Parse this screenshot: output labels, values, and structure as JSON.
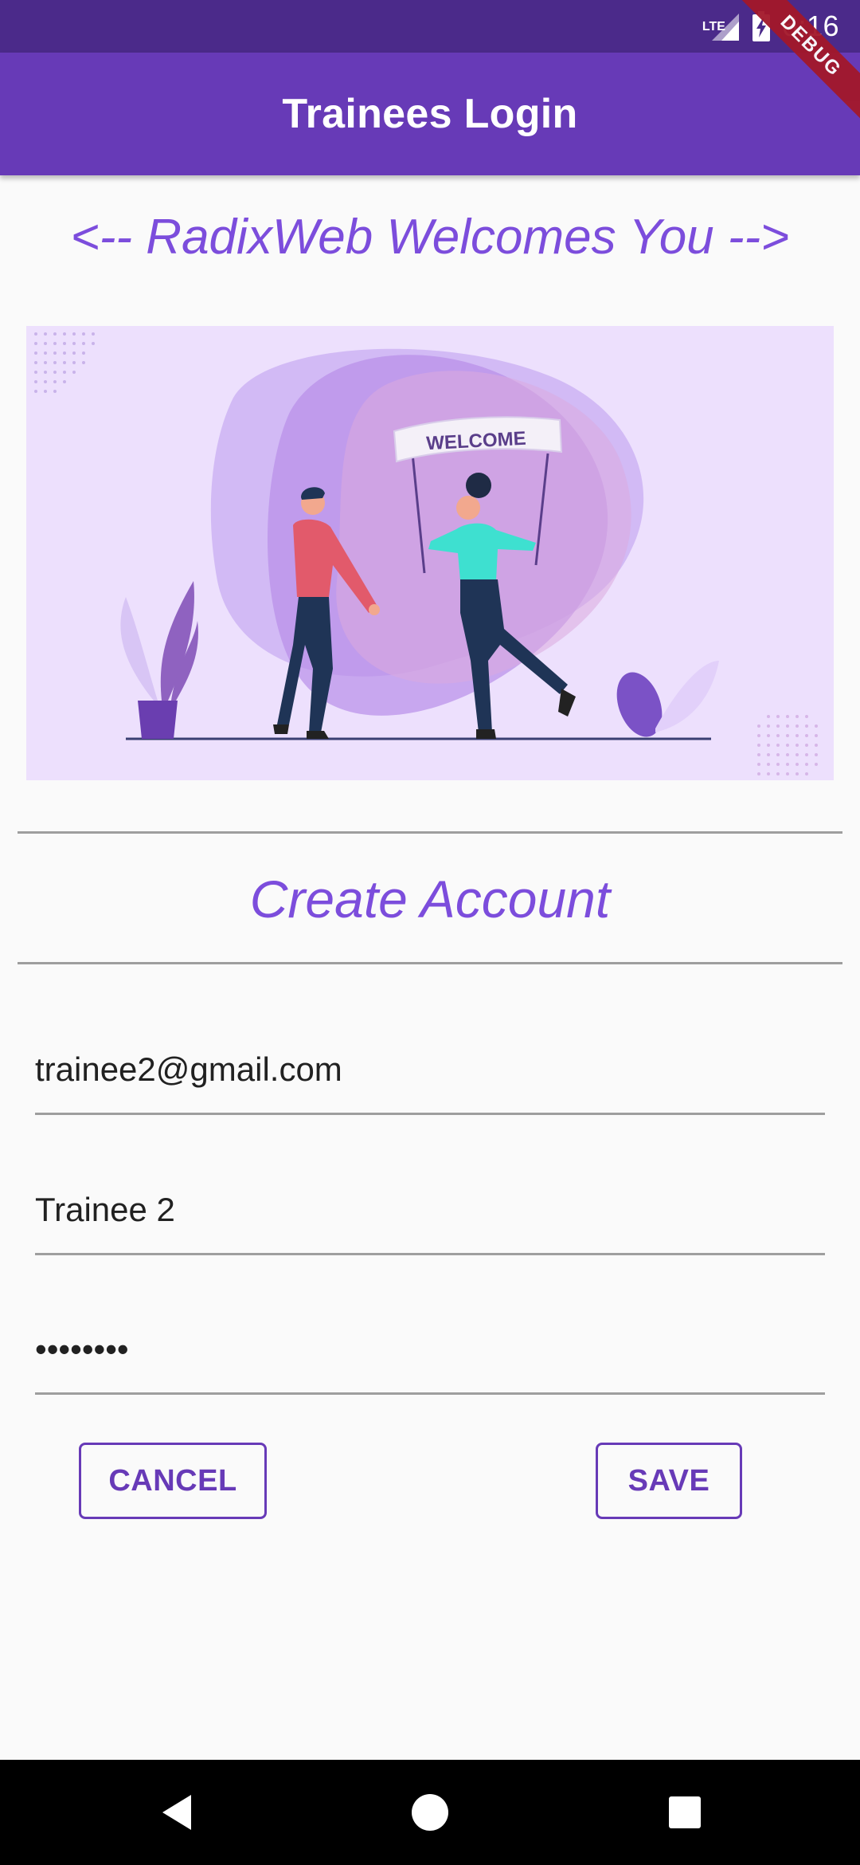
{
  "status_bar": {
    "network_label": "LTE",
    "time": "6:16"
  },
  "debug_banner": {
    "label": "DEBUG"
  },
  "app_bar": {
    "title": "Trainees Login"
  },
  "welcome": {
    "text": "<-- RadixWeb Welcomes You -->"
  },
  "illustration": {
    "banner_text": "WELCOME"
  },
  "form": {
    "title": "Create Account",
    "email_value": "trainee2@gmail.com",
    "name_value": "Trainee 2",
    "password_value": "••••••••"
  },
  "buttons": {
    "cancel_label": "CANCEL",
    "save_label": "SAVE"
  },
  "colors": {
    "primary": "#673ab7",
    "status_bar": "#4b2a8a",
    "accent_text": "#7c4ddc",
    "illustration_bg": "#ede0fd"
  },
  "icons": {
    "signal": "signal-icon",
    "battery": "battery-charging-icon",
    "nav_back": "back-triangle-icon",
    "nav_home": "home-circle-icon",
    "nav_recents": "recents-square-icon"
  }
}
